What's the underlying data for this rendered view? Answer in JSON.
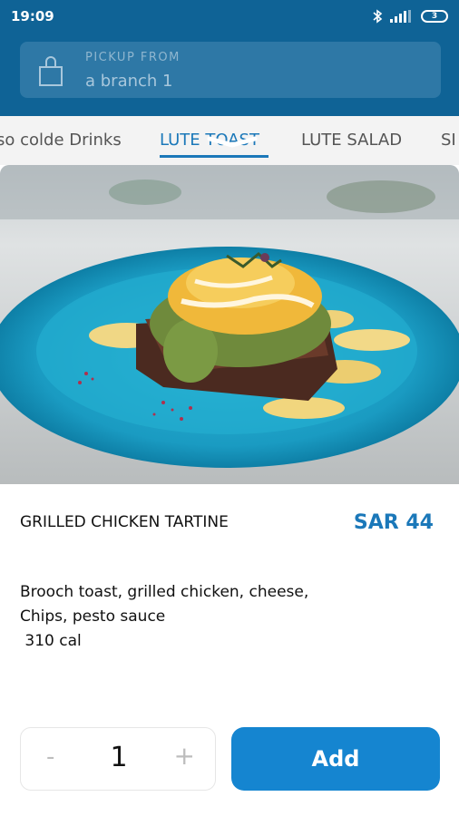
{
  "status_bar": {
    "time": "19:09",
    "battery": "3"
  },
  "pickup": {
    "caption": "PICKUP FROM",
    "branch": "a branch 1"
  },
  "tabs": [
    {
      "label": "so colde Drinks",
      "active": false
    },
    {
      "label": "LUTE TOAST",
      "active": true
    },
    {
      "label": "LUTE SALAD",
      "active": false
    },
    {
      "label": "SI",
      "active": false
    }
  ],
  "product": {
    "name": "GRILLED CHICKEN TARTINE",
    "price": "SAR 44",
    "description_lines": [
      "Brooch toast, grilled chicken, cheese,",
      "Chips, pesto sauce",
      " 310 cal"
    ]
  },
  "order": {
    "quantity": "1",
    "minus_label": "-",
    "plus_label": "+",
    "add_label": "Add"
  },
  "colors": {
    "brand": "#0f6396",
    "accent": "#1585d0",
    "price": "#1b78b9"
  }
}
